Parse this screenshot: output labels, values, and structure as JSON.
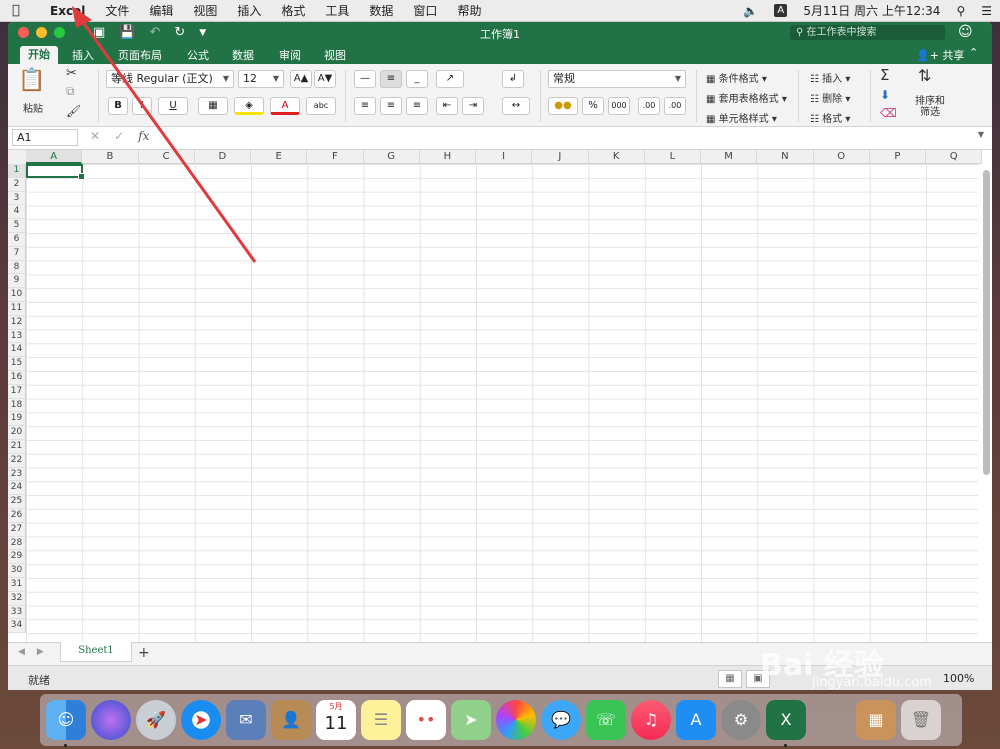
{
  "menubar": {
    "apple": "",
    "items": [
      "Excel",
      "文件",
      "编辑",
      "视图",
      "插入",
      "格式",
      "工具",
      "数据",
      "窗口",
      "帮助"
    ],
    "input_icon": "A",
    "datetime": "5月11日 周六 上午12:34"
  },
  "window": {
    "title": "工作簿1",
    "search_placeholder": "在工作表中搜索",
    "tabs": [
      "开始",
      "插入",
      "页面布局",
      "公式",
      "数据",
      "审阅",
      "视图"
    ],
    "active_tab": "开始",
    "share_label": "共享"
  },
  "ribbon": {
    "paste_label": "粘贴",
    "font_name": "等线 Regular (正文)",
    "font_size": "12",
    "number_format": "常规",
    "conditional_format": "条件格式",
    "table_format": "套用表格格式",
    "cell_style": "单元格样式",
    "insert_label": "插入",
    "delete_label": "删除",
    "format_label": "格式",
    "sort_filter_label": "排序和筛选",
    "bold": "B",
    "italic": "I",
    "underline": "U",
    "percent": "%",
    "thousands": "000",
    "dec_up": ".00",
    "dec_down": ".00"
  },
  "formula_bar": {
    "name_box": "A1",
    "fx": "fx"
  },
  "sheet": {
    "columns": [
      "A",
      "B",
      "C",
      "D",
      "E",
      "F",
      "G",
      "H",
      "I",
      "J",
      "K",
      "L",
      "M",
      "N",
      "O",
      "P",
      "Q"
    ],
    "rows": [
      "1",
      "2",
      "3",
      "4",
      "5",
      "6",
      "7",
      "8",
      "9",
      "10",
      "11",
      "12",
      "13",
      "14",
      "15",
      "16",
      "17",
      "18",
      "19",
      "20",
      "21",
      "22",
      "23",
      "24",
      "25",
      "26",
      "27",
      "28",
      "29",
      "30",
      "31",
      "32",
      "33",
      "34"
    ],
    "selected_cell": "A1"
  },
  "sheet_tabs": {
    "tabs": [
      "Sheet1"
    ],
    "add": "+"
  },
  "statusbar": {
    "status": "就绪",
    "zoom": "100%"
  },
  "dock": {
    "calendar_month": "5月",
    "calendar_day": "11"
  },
  "watermark": {
    "brand": "Bai 经验",
    "url": "jingyan.baidu.com"
  },
  "colors": {
    "accent": "#217346",
    "arrow": "#e03a3a"
  }
}
